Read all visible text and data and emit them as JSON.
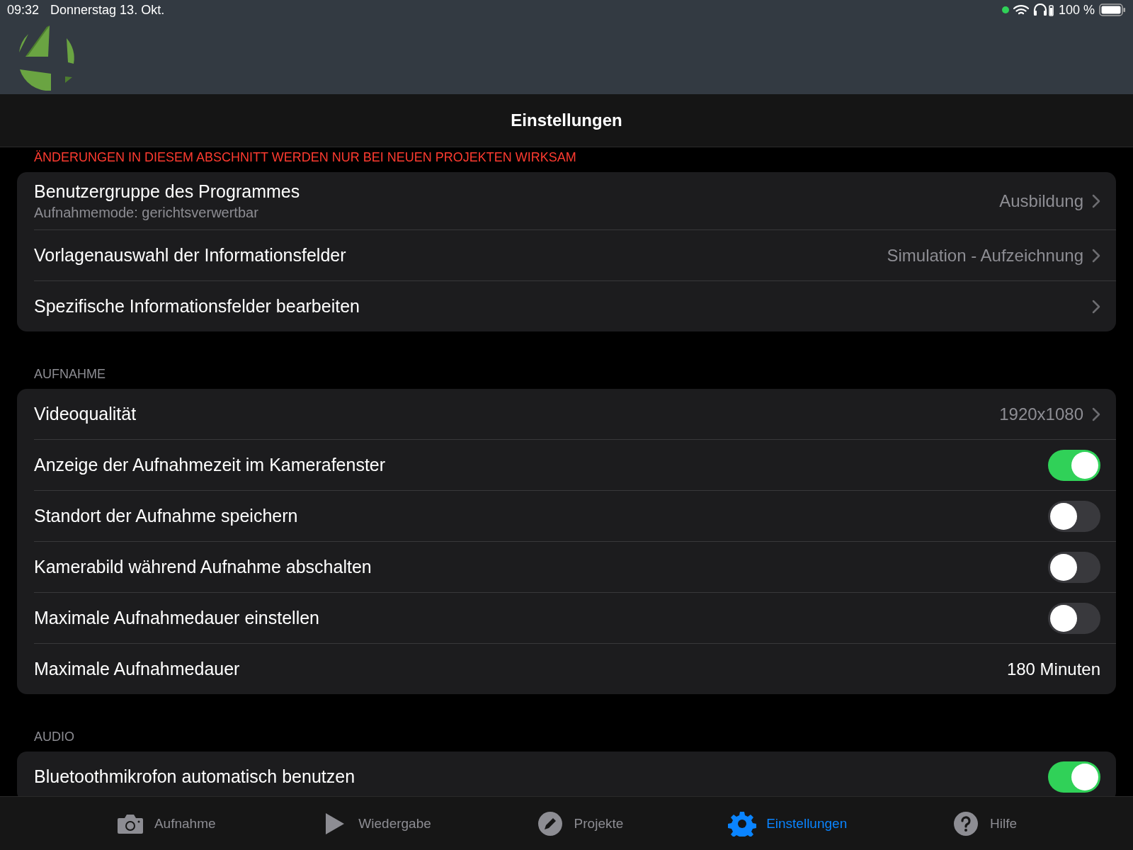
{
  "status_bar": {
    "time": "09:32",
    "date": "Donnerstag 13. Okt.",
    "battery": "100 %"
  },
  "nav_bar": {
    "title": "Einstellungen"
  },
  "sections": [
    {
      "header": "ÄNDERUNGEN IN DIESEM ABSCHNITT WERDEN NUR BEI NEUEN PROJEKTEN WIRKSAM",
      "warning": true,
      "rows": [
        {
          "kind": "nav",
          "title": "Benutzergruppe des Programmes",
          "subtitle": "Aufnahmemode: gerichtsverwertbar",
          "value": "Ausbildung"
        },
        {
          "kind": "nav",
          "title": "Vorlagenauswahl der Informationsfelder",
          "value": "Simulation - Aufzeichnung"
        },
        {
          "kind": "nav",
          "title": "Spezifische Informationsfelder bearbeiten"
        }
      ]
    },
    {
      "header": "AUFNAHME",
      "warning": false,
      "rows": [
        {
          "kind": "nav",
          "title": "Videoqualität",
          "value": "1920x1080"
        },
        {
          "kind": "toggle",
          "title": "Anzeige der Aufnahmezeit im Kamerafenster",
          "on": true
        },
        {
          "kind": "toggle",
          "title": "Standort der Aufnahme speichern",
          "on": false
        },
        {
          "kind": "toggle",
          "title": "Kamerabild während Aufnahme abschalten",
          "on": false
        },
        {
          "kind": "toggle",
          "title": "Maximale Aufnahmedauer einstellen",
          "on": false
        },
        {
          "kind": "value",
          "title": "Maximale Aufnahmedauer",
          "value": "180 Minuten"
        }
      ]
    },
    {
      "header": "AUDIO",
      "warning": false,
      "rows": [
        {
          "kind": "toggle",
          "title": "Bluetoothmikrofon automatisch benutzen",
          "on": true
        }
      ]
    }
  ],
  "tab_bar": [
    {
      "kind": "camera",
      "label": "Aufnahme",
      "selected": false
    },
    {
      "kind": "play",
      "label": "Wiedergabe",
      "selected": false
    },
    {
      "kind": "pencil",
      "label": "Projekte",
      "selected": false
    },
    {
      "kind": "gear",
      "label": "Einstellungen",
      "selected": true
    },
    {
      "kind": "help",
      "label": "Hilfe",
      "selected": false
    }
  ]
}
